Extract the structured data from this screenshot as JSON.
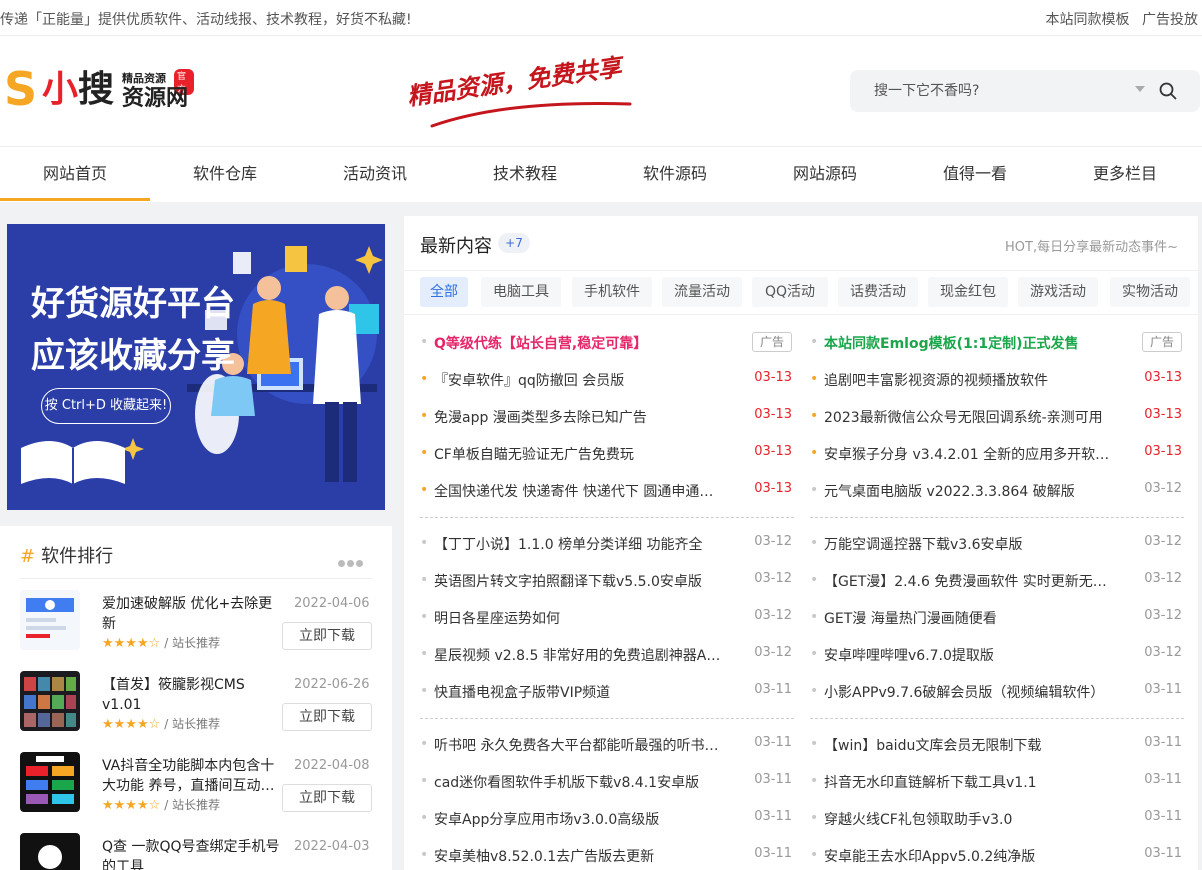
{
  "topbar": {
    "slogan": "传递「正能量」提供优质软件、活动线报、技术教程，好货不私藏!",
    "links": [
      "本站同款模板",
      "广告投放"
    ]
  },
  "logo": {
    "letter": "S",
    "name_a": "小",
    "name_b": "搜",
    "small": "精品资源",
    "badge": "官方",
    "big": "资源网"
  },
  "motto": "精品资源，免费共享",
  "search": {
    "placeholder": "搜一下它不香吗?"
  },
  "nav": [
    "网站首页",
    "软件仓库",
    "活动资讯",
    "技术教程",
    "软件源码",
    "网站源码",
    "值得一看",
    "更多栏目"
  ],
  "banner": {
    "line1": "好货源好平台",
    "line2": "应该收藏分享",
    "button": "按 Ctrl+D 收藏起来!"
  },
  "ranking": {
    "title": "软件排行",
    "download_label": "立即下载",
    "stars": "★★★★☆",
    "tag": "/ 站长推荐",
    "items": [
      {
        "name": "爱加速破解版 优化+去除更新",
        "date": "2022-04-06"
      },
      {
        "name": "【首发】筱朧影视CMS v1.01",
        "date": "2022-06-26"
      },
      {
        "name": "VA抖音全功能脚本内包含十大功能 养号，直播间互动…",
        "date": "2022-04-08"
      },
      {
        "name": "Q查 一款QQ号查绑定手机号的工具",
        "date": "2022-04-03"
      }
    ]
  },
  "latest": {
    "title": "最新内容",
    "count": "+7",
    "hint": "HOT,每日分享最新动态事件~",
    "tabs": [
      "全部",
      "电脑工具",
      "手机软件",
      "流量活动",
      "QQ活动",
      "话费活动",
      "现金红包",
      "游戏活动",
      "实物活动"
    ],
    "ad_label": "广告",
    "left": [
      {
        "text": "Q等级代练【站长自营,稳定可靠】",
        "date": "",
        "style": "ad-pink"
      },
      {
        "text": "『安卓软件』qq防撤回 会员版",
        "date": "03-13",
        "style": "hot"
      },
      {
        "text": "免漫app 漫画类型多去除已知广告",
        "date": "03-13",
        "style": "hot"
      },
      {
        "text": "CF单板自瞄无验证无广告免费玩",
        "date": "03-13",
        "style": "hot"
      },
      {
        "text": "全国快递代发 快递寄件 快递代下 圆通申通…",
        "date": "03-13",
        "style": "hot"
      },
      {
        "text": "【丁丁小说】1.1.0 榜单分类详细 功能齐全",
        "date": "03-12",
        "style": "normal"
      },
      {
        "text": "英语图片转文字拍照翻译下载v5.5.0安卓版",
        "date": "03-12",
        "style": "normal"
      },
      {
        "text": "明日各星座运势如何",
        "date": "03-12",
        "style": "normal"
      },
      {
        "text": "星辰视频 v2.8.5 非常好用的免费追剧神器A…",
        "date": "03-12",
        "style": "normal"
      },
      {
        "text": "快直播电视盒子版带VIP频道",
        "date": "03-11",
        "style": "normal"
      },
      {
        "text": "听书吧 永久免费各大平台都能听最强的听书…",
        "date": "03-11",
        "style": "normal"
      },
      {
        "text": "cad迷你看图软件手机版下载v8.4.1安卓版",
        "date": "03-11",
        "style": "normal"
      },
      {
        "text": "安卓App分享应用市场v3.0.0高级版",
        "date": "03-11",
        "style": "normal"
      },
      {
        "text": "安卓美柚v8.52.0.1去广告版去更新",
        "date": "03-11",
        "style": "normal"
      }
    ],
    "right": [
      {
        "text": "本站同款Emlog模板(1:1定制)正式发售",
        "date": "",
        "style": "ad-green"
      },
      {
        "text": "追剧吧丰富影视资源的视频播放软件",
        "date": "03-13",
        "style": "hot"
      },
      {
        "text": "2023最新微信公众号无限回调系统-亲测可用",
        "date": "03-13",
        "style": "hot"
      },
      {
        "text": "安卓猴子分身 v3.4.2.01 全新的应用多开软…",
        "date": "03-13",
        "style": "hot"
      },
      {
        "text": "元气桌面电脑版 v2022.3.3.864 破解版",
        "date": "03-12",
        "style": "normal"
      },
      {
        "text": "万能空调遥控器下载v3.6安卓版",
        "date": "03-12",
        "style": "normal"
      },
      {
        "text": "【GET漫】2.4.6 免费漫画软件 实时更新无…",
        "date": "03-12",
        "style": "normal"
      },
      {
        "text": "GET漫 海量热门漫画随便看",
        "date": "03-12",
        "style": "normal"
      },
      {
        "text": "安卓哔哩哔哩v6.7.0提取版",
        "date": "03-12",
        "style": "normal"
      },
      {
        "text": "小影APPv9.7.6破解会员版（视频编辑软件）",
        "date": "03-11",
        "style": "normal"
      },
      {
        "text": "【win】baidu文库会员无限制下载",
        "date": "03-11",
        "style": "normal"
      },
      {
        "text": "抖音无水印直链解析下载工具v1.1",
        "date": "03-11",
        "style": "normal"
      },
      {
        "text": "穿越火线CF礼包领取助手v3.0",
        "date": "03-11",
        "style": "normal"
      },
      {
        "text": "安卓能王去水印Appv5.0.2纯净版",
        "date": "03-11",
        "style": "normal"
      }
    ]
  },
  "colors": {
    "accent": "#f5a623",
    "brand_red": "#e8212a",
    "ad_pink": "#e5276a",
    "ad_green": "#1aa64a",
    "tab_active": "#2f6fe0",
    "banner_bg": "#2b3ea8"
  }
}
